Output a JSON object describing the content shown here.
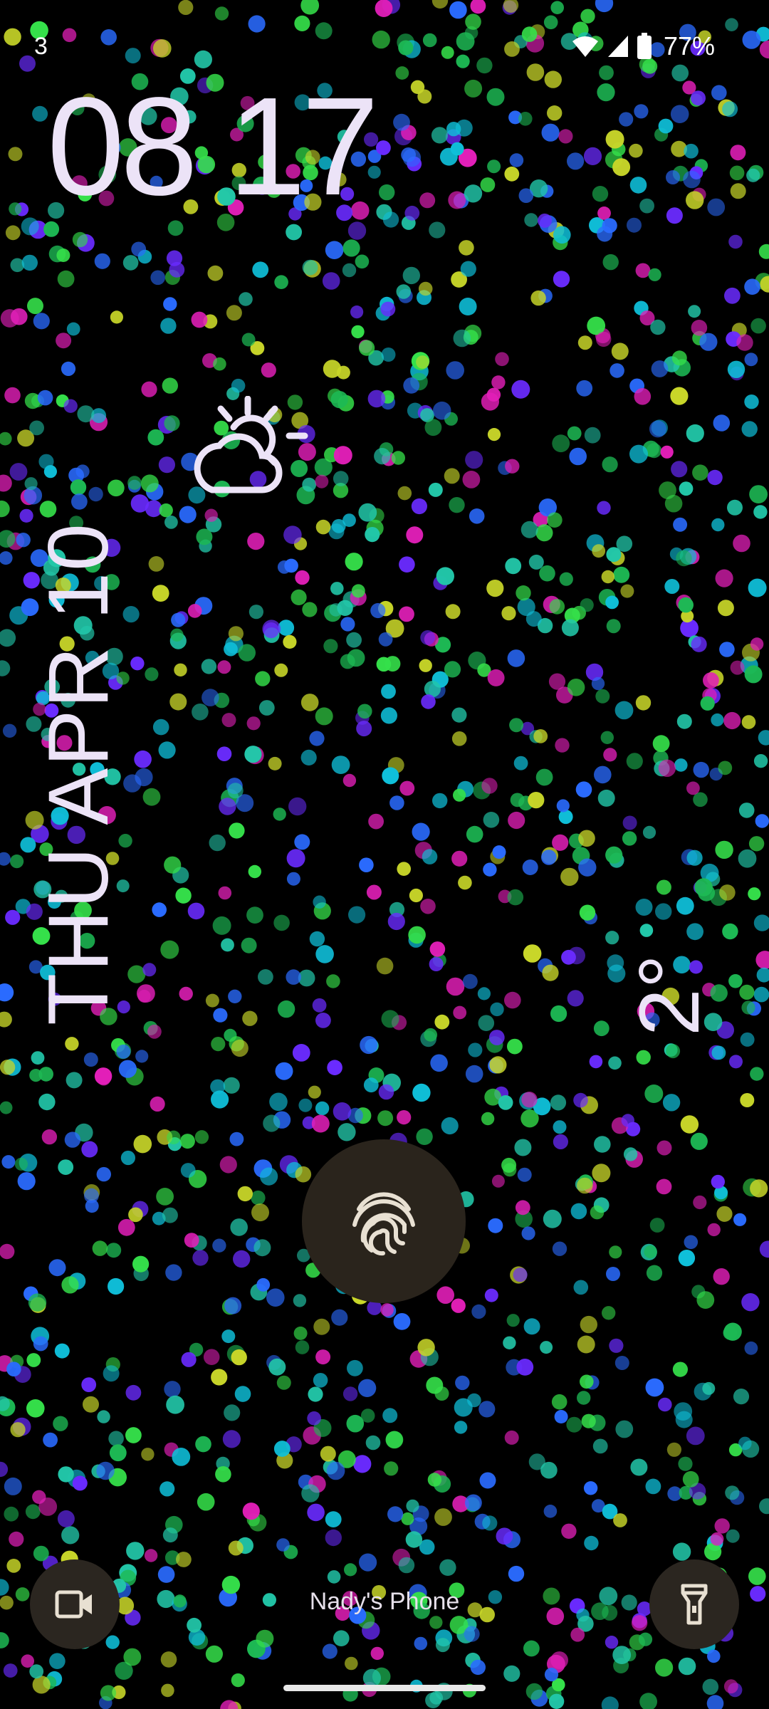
{
  "status_bar": {
    "notification_count": "3",
    "battery_percent": "77%",
    "icons": [
      "wifi-icon",
      "signal-icon",
      "battery-icon"
    ]
  },
  "lock_screen": {
    "time": "08 17",
    "date": "THU APR 10",
    "weather_icon": "partly-cloudy-sun-icon",
    "temperature": "2°",
    "owner_label": "Nady's Phone"
  },
  "shortcuts": {
    "left": "video-camera-icon",
    "center": "fingerprint-icon",
    "right": "flashlight-icon"
  },
  "colors": {
    "background": "#000000",
    "text": "#ECE3F7",
    "button_bg": "#2B2620",
    "dot_palette": [
      "#1db954",
      "#22c7a9",
      "#2a6bff",
      "#6a2bff",
      "#e21fb8",
      "#c8d629",
      "#0fbfd9",
      "#35e04a"
    ]
  }
}
